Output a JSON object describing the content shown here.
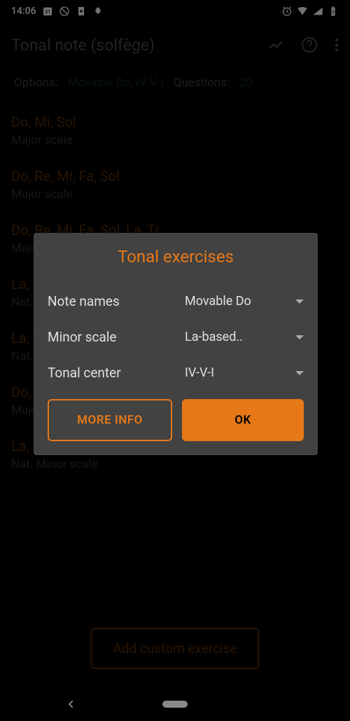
{
  "statusBar": {
    "time": "14:06"
  },
  "appBar": {
    "title": "Tonal note (solfège)"
  },
  "filterBar": {
    "optionsLabel": "Options:",
    "optionsValue": "Movable Do, IV-V-I",
    "questionsLabel": "Questions:",
    "questionsValue": "20"
  },
  "exercises": [
    {
      "title": "Do, Mi, Sol",
      "subtitle": "Major scale"
    },
    {
      "title": "Do, Re, Mi, Fa, Sol",
      "subtitle": "Major scale"
    },
    {
      "title": "Do, Re, Mi, Fa, Sol, La, Ti",
      "subtitle": "Major scale"
    },
    {
      "title": "La, Do, Mi",
      "subtitle": "Nat. Minor scale"
    },
    {
      "title": "La, Ti, Do, Re, Mi",
      "subtitle": "Nat. Minor scale"
    },
    {
      "title": "Do, Mi, Sol",
      "subtitle": "Major scale"
    },
    {
      "title": "La, Do, Mi",
      "subtitle": "Nat. Minor scale"
    }
  ],
  "addButton": "Add custom exercise",
  "dialog": {
    "title": "Tonal exercises",
    "rows": [
      {
        "label": "Note names",
        "value": "Movable Do"
      },
      {
        "label": "Minor scale",
        "value": "La-based.."
      },
      {
        "label": "Tonal center",
        "value": "IV-V-I"
      }
    ],
    "moreInfo": "MORE INFO",
    "ok": "OK"
  }
}
